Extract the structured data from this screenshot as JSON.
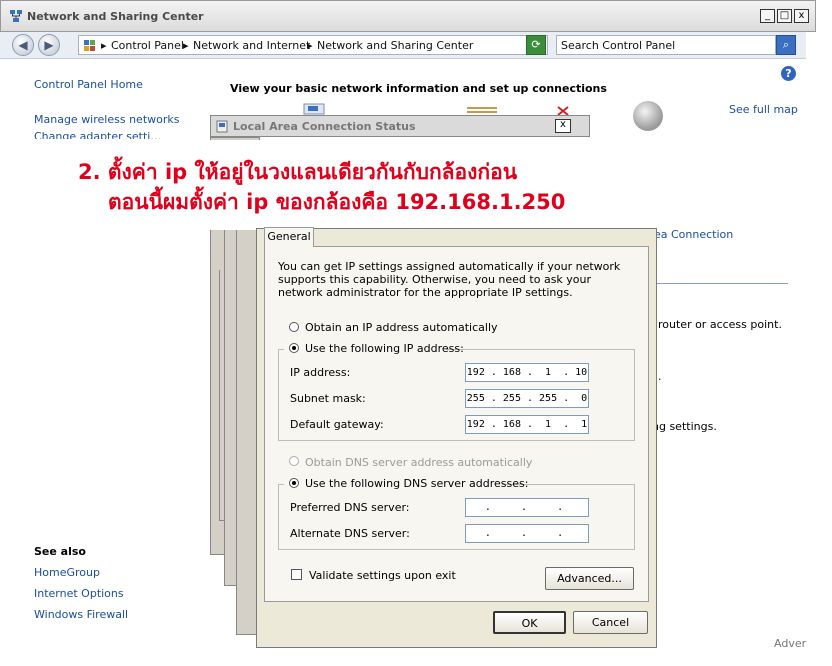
{
  "window": {
    "title": "Network and Sharing Center",
    "controls": [
      "_",
      "□",
      "x"
    ]
  },
  "toolbar": {
    "breadcrumbs": [
      "Control Panel",
      "Network and Internet",
      "Network and Sharing Center"
    ],
    "search_placeholder": "Search Control Panel"
  },
  "sidebar": {
    "home": "Control Panel Home",
    "items": [
      "Manage wireless networks",
      "Change adapter setti..."
    ],
    "see_also_heading": "See also",
    "see_also": [
      "HomeGroup",
      "Internet Options",
      "Windows Firewall"
    ]
  },
  "main": {
    "heading": "View your basic network information and set up connections",
    "see_full_map": "See full map",
    "partial_texts": [
      "ea Connection",
      "router or access point.",
      ".",
      "ng settings."
    ],
    "corner_text": "Adver"
  },
  "status_dialog": {
    "title": "Local Area Connection Status",
    "close": "x"
  },
  "annotation": {
    "line1": "2. ตั้งค่า ip ให้อยู่ในวงแลนเดียวกันกับกล้องก่อน",
    "line2": "ตอนนี้ผมตั้งค่า ip ของกล้องคือ 192.168.1.250"
  },
  "ipv4": {
    "tab": "General",
    "description": "You can get IP settings assigned automatically if your network supports this capability. Otherwise, you need to ask your network administrator for the appropriate IP settings.",
    "auto_ip": "Obtain an IP address automatically",
    "manual_ip": "Use the following IP address:",
    "ip_label": "IP address:",
    "ip_value": "192 . 168 .  1  . 10",
    "mask_label": "Subnet mask:",
    "mask_value": "255 . 255 . 255 .  0",
    "gateway_label": "Default gateway:",
    "gateway_value": "192 . 168 .  1  .  1",
    "auto_dns": "Obtain DNS server address automatically",
    "manual_dns": "Use the following DNS server addresses:",
    "pref_dns_label": "Preferred DNS server:",
    "pref_dns_value": " .     .     .  ",
    "alt_dns_label": "Alternate DNS server:",
    "alt_dns_value": " .     .     .  ",
    "validate": "Validate settings upon exit",
    "advanced": "Advanced...",
    "ok": "OK",
    "cancel": "Cancel"
  }
}
